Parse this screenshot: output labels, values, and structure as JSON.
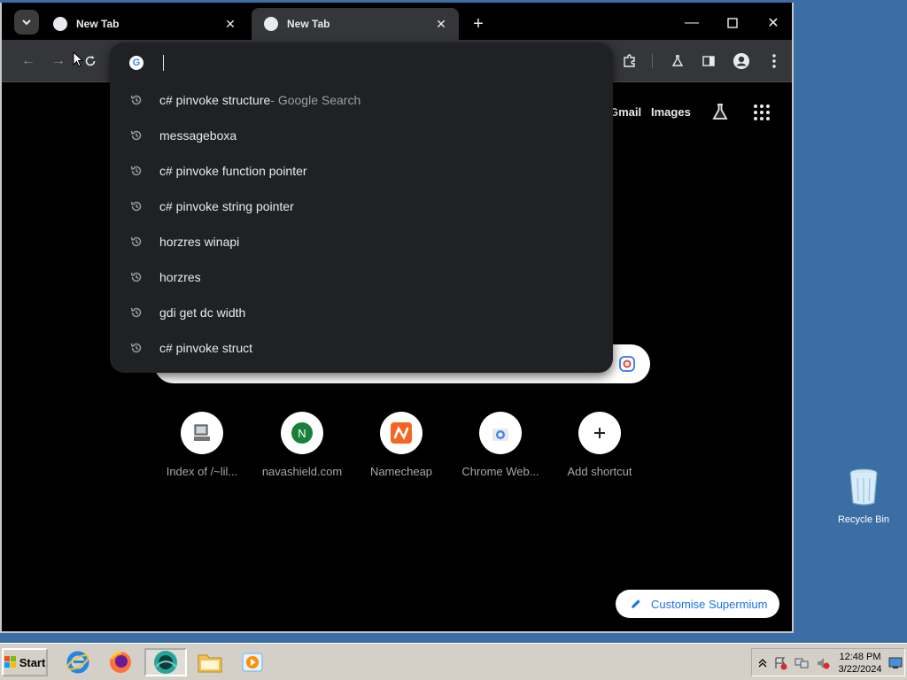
{
  "tabs": [
    {
      "label": "New Tab",
      "active": false
    },
    {
      "label": "New Tab",
      "active": true
    }
  ],
  "omnibox": {
    "value": "",
    "suggestions": [
      {
        "text": "c# pinvoke structure",
        "suffix": " - Google Search"
      },
      {
        "text": "messageboxa",
        "suffix": ""
      },
      {
        "text": "c# pinvoke function pointer",
        "suffix": ""
      },
      {
        "text": "c# pinvoke string pointer",
        "suffix": ""
      },
      {
        "text": "horzres winapi",
        "suffix": ""
      },
      {
        "text": "horzres",
        "suffix": ""
      },
      {
        "text": "gdi get dc width",
        "suffix": ""
      },
      {
        "text": "c# pinvoke struct",
        "suffix": ""
      }
    ]
  },
  "ntp": {
    "links": {
      "gmail": "Gmail",
      "images": "Images"
    },
    "shortcuts": [
      {
        "label": "Index of /~lil..."
      },
      {
        "label": "navashield.com",
        "letter": "N"
      },
      {
        "label": "Namecheap"
      },
      {
        "label": "Chrome Web..."
      },
      {
        "label": "Add shortcut"
      }
    ],
    "customise_label": "Customise Supermium"
  },
  "desktop": {
    "recycle_bin": "Recycle Bin"
  },
  "taskbar": {
    "start_label": "Start",
    "time": "12:48 PM",
    "date": "3/22/2024"
  },
  "colors": {
    "accent": "#1a73e8",
    "toolbar": "#35363a",
    "dropdown": "#202124",
    "desktop": "#3a6ea5"
  }
}
